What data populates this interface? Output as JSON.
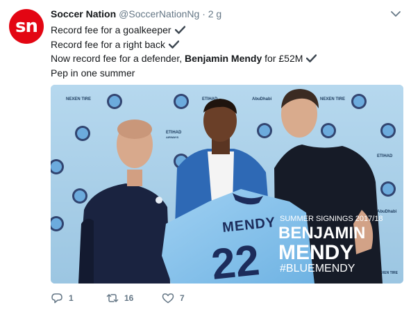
{
  "avatar": {
    "text": "sn",
    "color": "#e30613"
  },
  "header": {
    "name": "Soccer Nation",
    "handle": "@SoccerNationNg",
    "separator": "·",
    "time": "2 g"
  },
  "tweet": {
    "line1": "Record fee for a goalkeeper",
    "line2": "Record fee for a right back",
    "line3_prefix": "Now record fee for a defender, ",
    "line3_bold": "Benjamin Mendy",
    "line3_suffix": " for £52M",
    "line4": "Pep in one summer"
  },
  "photo": {
    "jersey_name": "MENDY",
    "jersey_number": "22",
    "overlay_top": "SUMMER SIGNINGS 2017/18",
    "overlay_first": "BENJAMIN",
    "overlay_last": "MENDY",
    "overlay_tag": "#BLUEMENDY",
    "sponsor_nexen": "NEXEN TIRE",
    "sponsor_etihad": "ETIHAD",
    "sponsor_etihad_sub": "AIRWAYS",
    "sponsor_abudhabi": "AbuDhabi",
    "background_color": "#a8cde6"
  },
  "actions": {
    "replies": "1",
    "retweets": "16",
    "likes": "7"
  },
  "colors": {
    "text": "#14171a",
    "muted": "#657786"
  }
}
